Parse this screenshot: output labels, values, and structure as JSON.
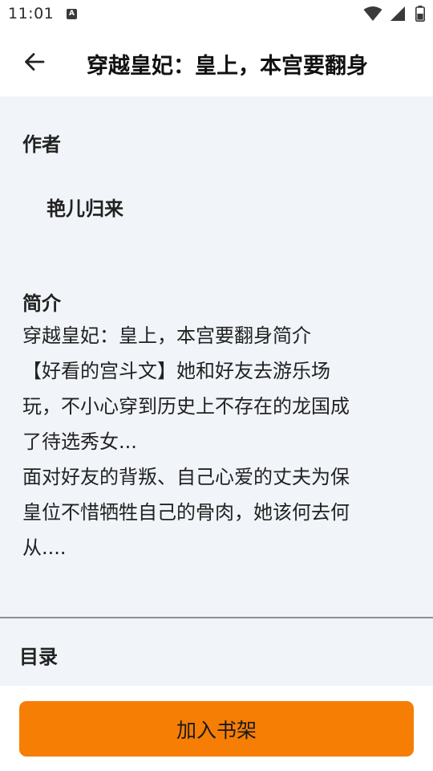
{
  "status_bar": {
    "time": "11:01",
    "notification_icon_letter": "A",
    "icons": [
      "wifi-icon",
      "signal-icon",
      "battery-icon"
    ]
  },
  "app_bar": {
    "back_icon": "arrow-left-icon",
    "title": "穿越皇妃：皇上，本宫要翻身"
  },
  "book": {
    "author_heading": "作者",
    "author": "艳儿归来",
    "intro_heading": "简介",
    "intro_lines": [
      "穿越皇妃：皇上，本宫要翻身简介",
      "【好看的宫斗文】她和好友去游乐场",
      "玩，不小心穿到历史上不存在的龙国成",
      "了待选秀女...",
      "面对好友的背叛、自己心爱的丈夫为保",
      "皇位不惜牺牲自己的骨肉，她该何去何",
      "从...."
    ],
    "toc_heading": "目录"
  },
  "actions": {
    "add_to_shelf_label": "加入书架"
  },
  "colors": {
    "accent": "#f67e05",
    "content_background": "#f1f4f9",
    "text": "#222222"
  }
}
